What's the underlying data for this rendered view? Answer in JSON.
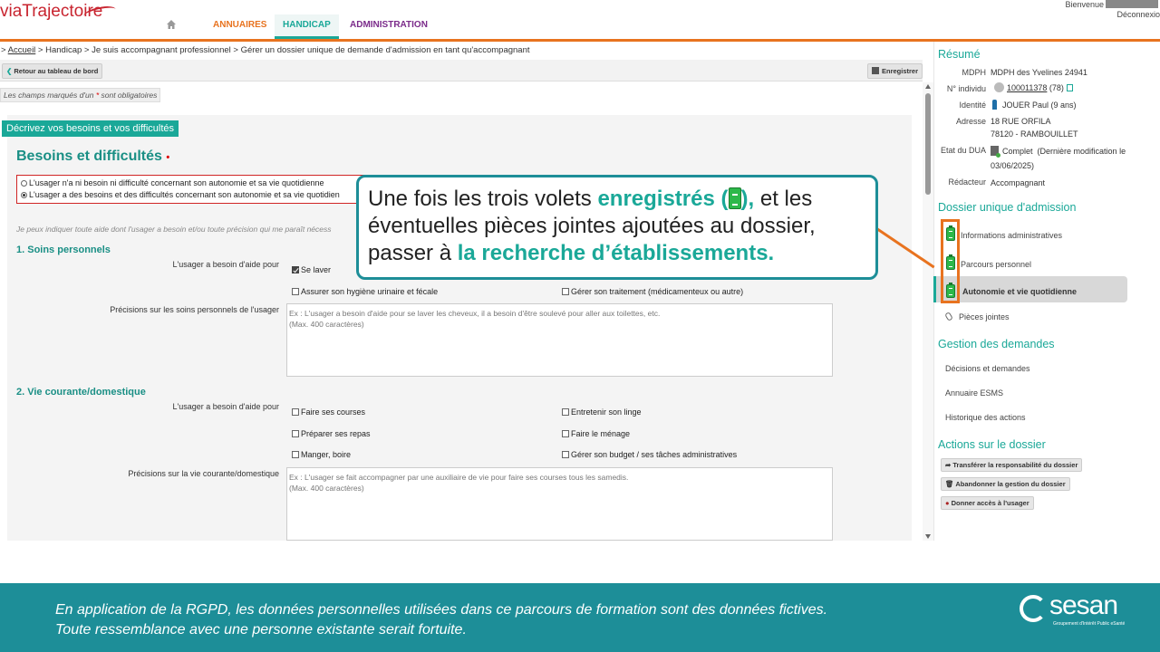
{
  "header": {
    "logo": "viaTrajectoire",
    "nav": [
      "ANNUAIRES",
      "HANDICAP",
      "ADMINISTRATION"
    ],
    "bienvenue": "Bienvenue",
    "deconnexion": "Déconnexio"
  },
  "breadcrumb": {
    "home": "Accueil",
    "rest": " > Handicap > Je suis accompagnant professionnel > Gérer un dossier unique de demande d'admission en tant qu'accompagnant"
  },
  "toolbar": {
    "back_label": "Retour au tableau de bord",
    "save_label": "Enregistrer"
  },
  "form": {
    "mandatory_prefix": "Les champs marqués d'un",
    "mandatory_star": "*",
    "mandatory_suffix": "sont obligatoires",
    "section_header": "Décrivez vos besoins et vos difficultés",
    "title": "Besoins et difficultés",
    "title_req": "•",
    "radio_options": [
      {
        "label": "L'usager n'a ni besoin ni difficulté concernant son autonomie et sa vie quotidienne",
        "selected": false
      },
      {
        "label": "L'usager a des besoins et des difficultés concernant son autonomie et sa vie quotidien",
        "selected": true
      }
    ],
    "hint": "Je peux indiquer toute aide dont l'usager a besoin et/ou toute précision qui me paraît nécess",
    "soins": {
      "title": "1. Soins personnels",
      "need_label": "L'usager a besoin d'aide pour",
      "checkboxes": [
        {
          "label": "Se laver",
          "checked": true
        },
        {
          "label": "Assurer son hygiène urinaire et fécale",
          "checked": false
        },
        {
          "label": "Gérer son traitement (médicamenteux ou autre)",
          "checked": false
        }
      ],
      "precisions_label": "Précisions sur les soins personnels de l'usager",
      "placeholder": "Ex : L'usager a besoin d'aide pour se laver les cheveux, il a besoin d'être soulevé pour aller aux toilettes, etc.\n(Max. 400 caractères)"
    },
    "vie": {
      "title": "2. Vie courante/domestique",
      "need_label": "L'usager a besoin d'aide pour",
      "checkboxes": [
        {
          "label": "Faire ses courses",
          "checked": false
        },
        {
          "label": "Entretenir son linge",
          "checked": false
        },
        {
          "label": "Préparer ses repas",
          "checked": false
        },
        {
          "label": "Faire le ménage",
          "checked": false
        },
        {
          "label": "Manger, boire",
          "checked": false
        },
        {
          "label": "Gérer son budget / ses tâches administratives",
          "checked": false
        }
      ],
      "precisions_label": "Précisions sur la vie courante/domestique",
      "placeholder": "Ex : L'usager se fait accompagner par une auxiliaire de vie pour faire ses courses tous les samedis.\n(Max. 400 caractères)"
    }
  },
  "callout": {
    "p1": "Une fois les trois volets ",
    "hl1": "enregistrés (",
    "hl1b": "),",
    "p2": " et les éventuelles pièces jointes ajoutées au dossier, passer à ",
    "hl2": "la recherche d’établissements."
  },
  "resume": {
    "title": "Résumé",
    "mdph_k": "MDPH",
    "mdph_v": "MDPH des Yvelines 24941",
    "indiv_k": "N° individu",
    "indiv_v": "100011378",
    "indiv_extra": " (78)",
    "ident_k": "Identité",
    "ident_v": "JOUER Paul (9 ans)",
    "addr_k": "Adresse",
    "addr_1": "18 RUE ORFILA",
    "addr_2": "78120 - RAMBOUILLET",
    "etat_k": "Etat du DUA",
    "etat_v": "Complet",
    "etat_extra": "(Dernière modification le",
    "etat_date": "03/06/2025)",
    "red_k": "Rédacteur",
    "red_v": "Accompagnant"
  },
  "dossier": {
    "title": "Dossier unique d'admission",
    "items": [
      "Informations administratives",
      "Parcours personnel",
      "Autonomie et vie quotidienne",
      "Pièces jointes"
    ]
  },
  "gestion": {
    "title": "Gestion des demandes",
    "items": [
      "Décisions et demandes",
      "Annuaire ESMS",
      "Historique des actions"
    ]
  },
  "actions": {
    "title": "Actions sur le dossier",
    "buttons": [
      "Transférer la responsabilité du dossier",
      "Abandonner la gestion du dossier",
      "Donner accès à l'usager"
    ]
  },
  "footer": {
    "line1": "En application de la RGPD, les données personnelles utilisées dans ce parcours de formation sont des données fictives.",
    "line2": "Toute ressemblance avec une personne existante serait fortuite.",
    "brand": "sesan",
    "brand_sub": "Groupement d'Intérêt Public eSanté"
  },
  "colors": {
    "accent": "#1aa898",
    "orange": "#e8731f",
    "footer": "#1d8e98",
    "required": "#d02525"
  }
}
